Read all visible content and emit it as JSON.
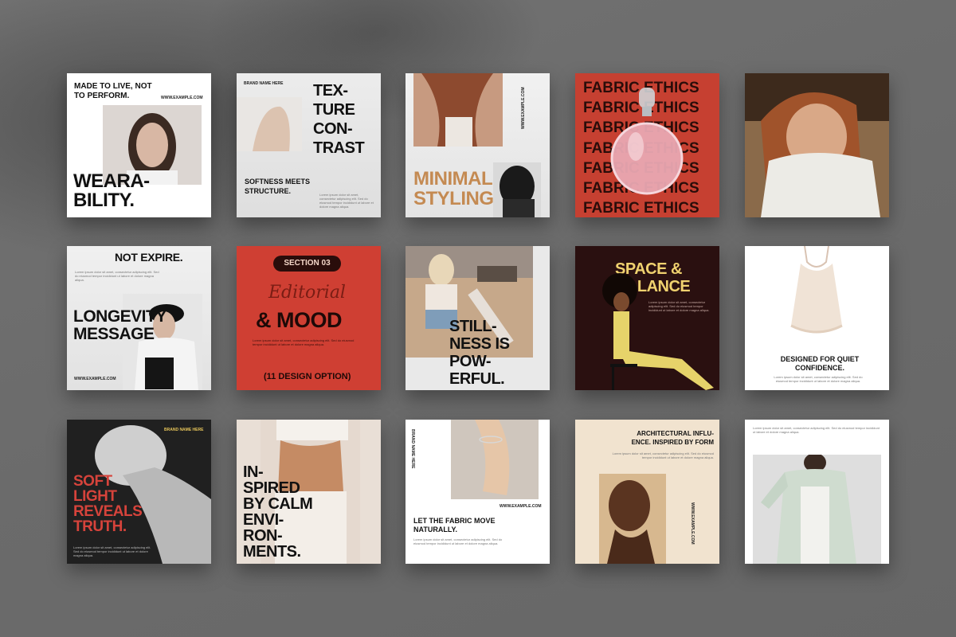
{
  "c1": {
    "headline": "MADE TO LIVE, NOT TO PERFORM.",
    "url": "WWW.EXAMPLE.COM",
    "big": "WEARA-\nBILITY."
  },
  "c2": {
    "brand": "BRAND NAME HERE",
    "big": "TEX-\nTURE\nCON-\nTRAST",
    "sub": "SOFTNESS MEETS STRUCTURE."
  },
  "c3": {
    "big": "MINIMAL\nSTYLING",
    "url": "WWW.EXAMPLE.COM"
  },
  "c4": {
    "repeat": [
      "FABRIC ETHICS",
      "FABRIC ETHICS",
      "FABRIC ETHICS",
      "FABRIC ETHICS",
      "FABRIC ETHICS",
      "FABRIC ETHICS",
      "FABRIC ETHICS"
    ]
  },
  "c6": {
    "top": "NOT EXPIRE.",
    "big": "LONGEVITY\nMESSAGE",
    "url": "WWW.EXAMPLE.COM"
  },
  "c7": {
    "pill": "SECTION 03",
    "script": "Editorial",
    "big": "& MOOD",
    "foot": "(11 DESIGN OPTION)"
  },
  "c8": {
    "big": "STILL-\nNESS IS\nPOW-\nERFUL."
  },
  "c9": {
    "big": "SPACE &\nBALANCE"
  },
  "c10": {
    "caption": "DESIGNED FOR QUIET CONFIDENCE."
  },
  "c11": {
    "brand": "BRAND NAME HERE",
    "big": "SOFT\nLIGHT\nREVEALS\nTRUTH."
  },
  "c12": {
    "big": "IN-\nSPIRED\nBY CALM\nENVI-\nRON-\nMENTS."
  },
  "c13": {
    "brand": "BRAND NAME HERE",
    "url": "WWW.EXAMPLE.COM",
    "caption": "LET THE FABRIC MOVE NATURALLY."
  },
  "c14": {
    "headline": "ARCHITECTURAL INFLU-\nENCE. INSPIRED BY FORM",
    "url": "WWW.EXAMPLE.COM"
  },
  "lorem": "Lorem ipsum dolor sit amet, consectetur adipiscing elit. Sed do eiusmod tempor incididunt ut labore et dolore magna aliqua."
}
